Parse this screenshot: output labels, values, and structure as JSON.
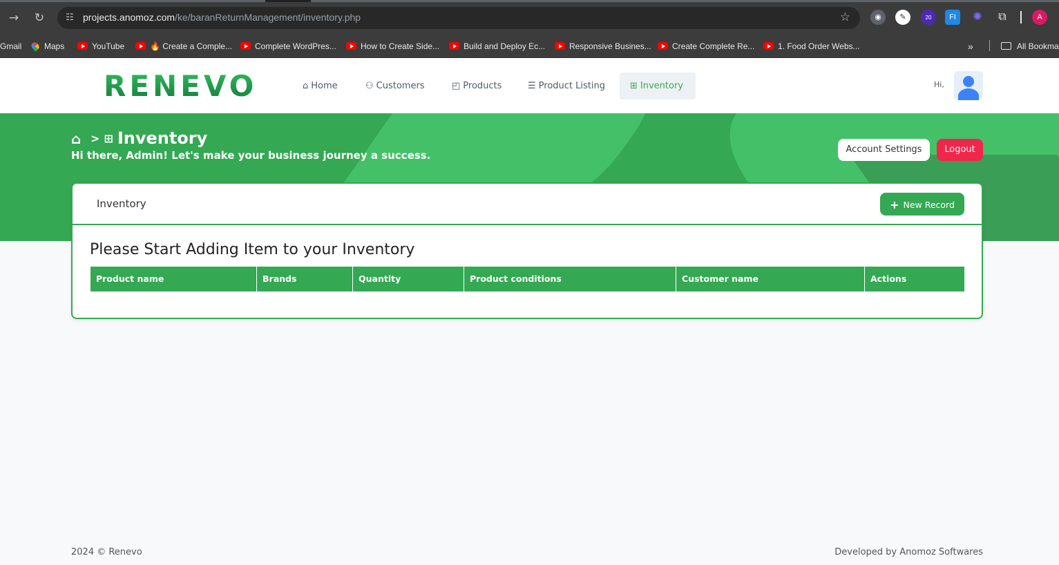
{
  "browser": {
    "url_host": "projects.anomoz.com",
    "url_path": "/ke/baranReturnManagement/inventory.php",
    "extension_badge": "20",
    "profile_initial": "A",
    "bookmarks": [
      {
        "label": "Gmail",
        "icon": "gmail-icon"
      },
      {
        "label": "Maps",
        "icon": "maps-icon"
      },
      {
        "label": "YouTube",
        "icon": "youtube-icon"
      },
      {
        "label": "🔥 Create a Comple...",
        "icon": "youtube-icon"
      },
      {
        "label": "Complete WordPres...",
        "icon": "youtube-icon"
      },
      {
        "label": "How to Create Side...",
        "icon": "youtube-icon"
      },
      {
        "label": "Build and Deploy Ec...",
        "icon": "youtube-icon"
      },
      {
        "label": "Responsive Busines...",
        "icon": "youtube-icon"
      },
      {
        "label": "Create Complete Re...",
        "icon": "youtube-icon"
      },
      {
        "label": "1. Food Order Webs...",
        "icon": "youtube-icon"
      }
    ],
    "all_bookmarks": "All Bookma"
  },
  "header": {
    "logo": "RENEVO",
    "nav": [
      {
        "label": "Home",
        "icon": "home-icon"
      },
      {
        "label": "Customers",
        "icon": "users-icon"
      },
      {
        "label": "Products",
        "icon": "bag-icon"
      },
      {
        "label": "Product Listing",
        "icon": "list-icon"
      },
      {
        "label": "Inventory",
        "icon": "sitemap-icon"
      }
    ],
    "hi": "Hi,"
  },
  "banner": {
    "crumb_title": "Inventory",
    "greeting": "Hi there, Admin! Let's make your business journey a success.",
    "account_settings": "Account Settings",
    "logout": "Logout"
  },
  "card": {
    "title": "Inventory",
    "new_record": "New Record",
    "empty_title": "Please Start Adding Item to your Inventory",
    "columns": [
      "Product name",
      "Brands",
      "Quantity",
      "Product conditions",
      "Customer name",
      "Actions"
    ]
  },
  "footer": {
    "left": "2024  © Renevo",
    "right": "Developed by Anomoz Softwares"
  },
  "colors": {
    "brand_green": "#34a853",
    "logout_red": "#f0264a"
  }
}
